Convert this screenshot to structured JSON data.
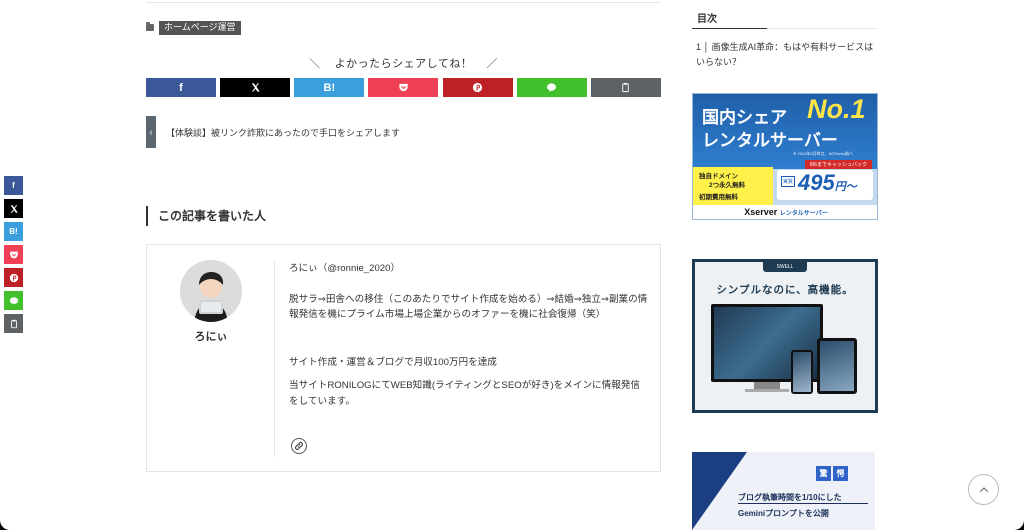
{
  "post": {
    "category": "ホームページ運営"
  },
  "share": {
    "heading": "よかったらシェアしてね！",
    "buttons": [
      {
        "name": "facebook",
        "label": "f",
        "color": "#3b5998"
      },
      {
        "name": "x",
        "label": "𝕏",
        "color": "#000000"
      },
      {
        "name": "hatena",
        "label": "B!",
        "color": "#3c9fdd"
      },
      {
        "name": "pocket",
        "label": "pocket",
        "color": "#ef4056"
      },
      {
        "name": "pinterest",
        "label": "P",
        "color": "#bd2126"
      },
      {
        "name": "line",
        "label": "LINE",
        "color": "#43c12d"
      },
      {
        "name": "copy",
        "label": "copy",
        "color": "#5f6264"
      }
    ]
  },
  "prev_post": {
    "arrow": "‹",
    "title": "【体験談】被リンク詐欺にあったので手口をシェアします"
  },
  "author_section": {
    "title": "この記事を書いた人",
    "name": "ろにぃ",
    "handle": "ろにぃ（@ronnie_2020）",
    "bio_1": "脱サラ⇒田舎への移住（このあたりでサイト作成を始める）⇒結婚⇒独立⇒副業の情報発信を機にプライム市場上場企業からのオファーを機に社会復帰（笑）",
    "bio_2": "サイト作成・運営＆ブログで月収100万円を達成",
    "bio_3": "当サイトRONILOGにてWEB知識(ライティングとSEOが好き)をメインに情報発信をしています。",
    "link_icon": "link-icon"
  },
  "toc": {
    "title": "目次",
    "items": [
      {
        "num": "1",
        "text": "画像生成AI革命：もはや有料サービスはいらない？"
      }
    ]
  },
  "ads": {
    "xserver": {
      "line1": "国内シェア",
      "no1": "No.1",
      "line2": "レンタルサーバー",
      "note": "※ 2024年5月時点、W3Techs調べ",
      "campaign": "8/6までキャッシュバック",
      "feature1": "独自ドメイン",
      "feature1b": "2つ永久無料",
      "feature2": "初期費用無料",
      "tag": "実質",
      "price": "495",
      "price_unit": "円〜",
      "brand": "Xserver",
      "brand_sub": "レンタルサーバー"
    },
    "swell": {
      "badge": "SWELL",
      "tagline": "シンプルなのに、高機能。"
    },
    "gemini": {
      "badge1": "驚",
      "badge2": "愕",
      "line1": "ブログ執筆時間を1/10にした",
      "line2": "Geminiプロンプトを公開"
    }
  },
  "back_to_top_icon": "chevron-up-icon"
}
